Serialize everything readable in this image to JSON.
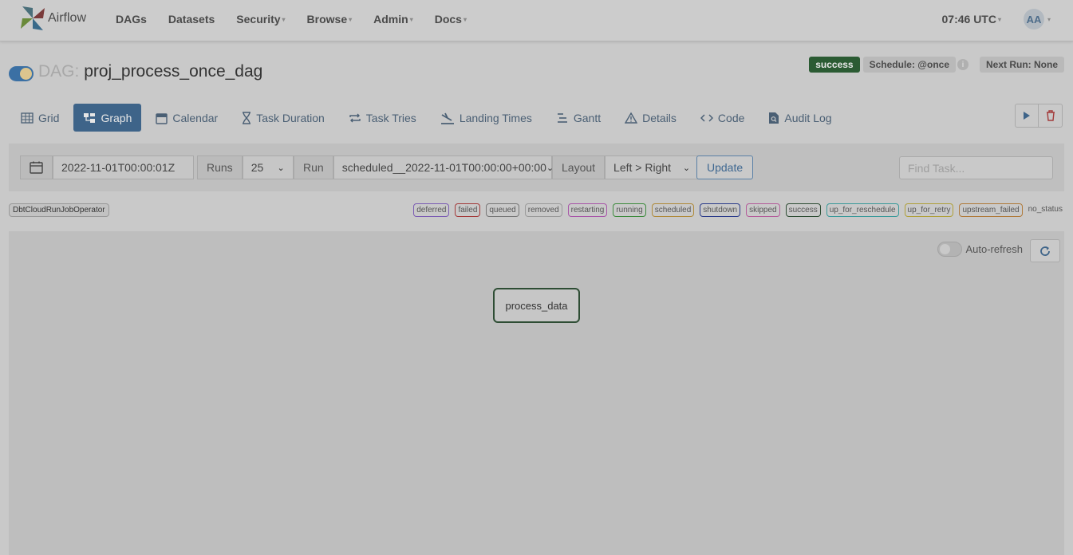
{
  "navbar": {
    "brand": "Airflow",
    "items": [
      {
        "label": "DAGs",
        "dropdown": false
      },
      {
        "label": "Datasets",
        "dropdown": false
      },
      {
        "label": "Security",
        "dropdown": true
      },
      {
        "label": "Browse",
        "dropdown": true
      },
      {
        "label": "Admin",
        "dropdown": true
      },
      {
        "label": "Docs",
        "dropdown": true
      }
    ],
    "time": "07:46 UTC",
    "avatar": "AA"
  },
  "dag": {
    "label": "DAG:",
    "name": "proj_process_once_dag",
    "status": "success",
    "schedule": "Schedule: @once",
    "next_run": "Next Run: None",
    "paused": false
  },
  "tabs": [
    {
      "label": "Grid",
      "icon": "grid-icon",
      "active": false
    },
    {
      "label": "Graph",
      "icon": "graph-icon",
      "active": true
    },
    {
      "label": "Calendar",
      "icon": "calendar-icon",
      "active": false
    },
    {
      "label": "Task Duration",
      "icon": "hourglass-icon",
      "active": false
    },
    {
      "label": "Task Tries",
      "icon": "repeat-icon",
      "active": false
    },
    {
      "label": "Landing Times",
      "icon": "landing-icon",
      "active": false
    },
    {
      "label": "Gantt",
      "icon": "gantt-icon",
      "active": false
    },
    {
      "label": "Details",
      "icon": "warning-icon",
      "active": false
    },
    {
      "label": "Code",
      "icon": "code-icon",
      "active": false
    },
    {
      "label": "Audit Log",
      "icon": "file-search-icon",
      "active": false
    }
  ],
  "filters": {
    "base_date": "2022-11-01T00:00:01Z",
    "runs_label": "Runs",
    "runs_value": "25",
    "run_label": "Run",
    "run_value": "scheduled__2022-11-01T00:00:00+00:00",
    "layout_label": "Layout",
    "layout_value": "Left > Right",
    "update_label": "Update",
    "find_placeholder": "Find Task..."
  },
  "legend": {
    "operator": "DbtCloudRunJobOperator",
    "states": [
      {
        "label": "deferred",
        "color": "#7b5cb3"
      },
      {
        "label": "failed",
        "color": "#a33a3a"
      },
      {
        "label": "queued",
        "color": "#777777"
      },
      {
        "label": "removed",
        "color": "#9a9a9a"
      },
      {
        "label": "restarting",
        "color": "#a855a8"
      },
      {
        "label": "running",
        "color": "#3d8b3d"
      },
      {
        "label": "scheduled",
        "color": "#b08a3a"
      },
      {
        "label": "shutdown",
        "color": "#2b3b8a"
      },
      {
        "label": "skipped",
        "color": "#b45c9a"
      },
      {
        "label": "success",
        "color": "#2e4d34"
      },
      {
        "label": "up_for_reschedule",
        "color": "#3a9a9a"
      },
      {
        "label": "up_for_retry",
        "color": "#b0a03a"
      },
      {
        "label": "upstream_failed",
        "color": "#b07a3a"
      }
    ],
    "no_status": "no_status"
  },
  "graph": {
    "auto_refresh_label": "Auto-refresh",
    "auto_refresh_on": false,
    "nodes": [
      {
        "label": "process_data",
        "state": "success"
      }
    ]
  }
}
